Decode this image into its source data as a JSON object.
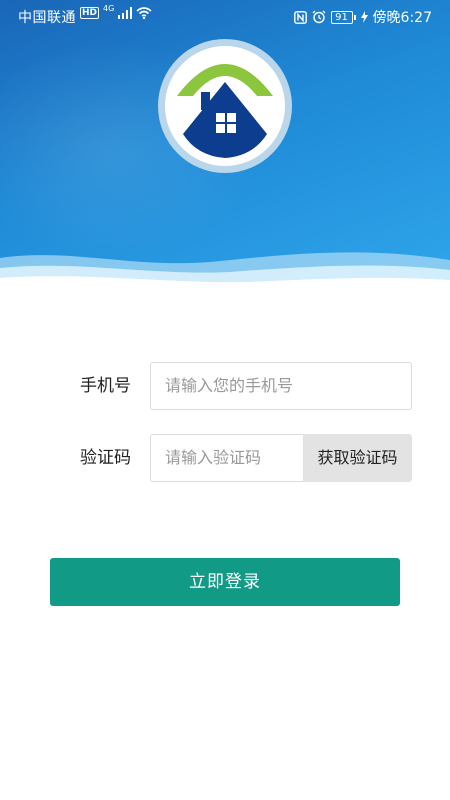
{
  "status_bar": {
    "carrier": "中国联通",
    "hd_badge": "HD",
    "network": "4G",
    "battery": "91",
    "time": "傍晚6:27"
  },
  "form": {
    "phone_label": "手机号",
    "phone_placeholder": "请输入您的手机号",
    "code_label": "验证码",
    "code_placeholder": "请输入验证码",
    "get_code_button": "获取验证码"
  },
  "login_button": "立即登录",
  "colors": {
    "header_blue": "#1f8ad6",
    "login_green": "#119a86",
    "logo_roof_green": "#8cc63f",
    "logo_house_navy": "#0d3d8f"
  }
}
